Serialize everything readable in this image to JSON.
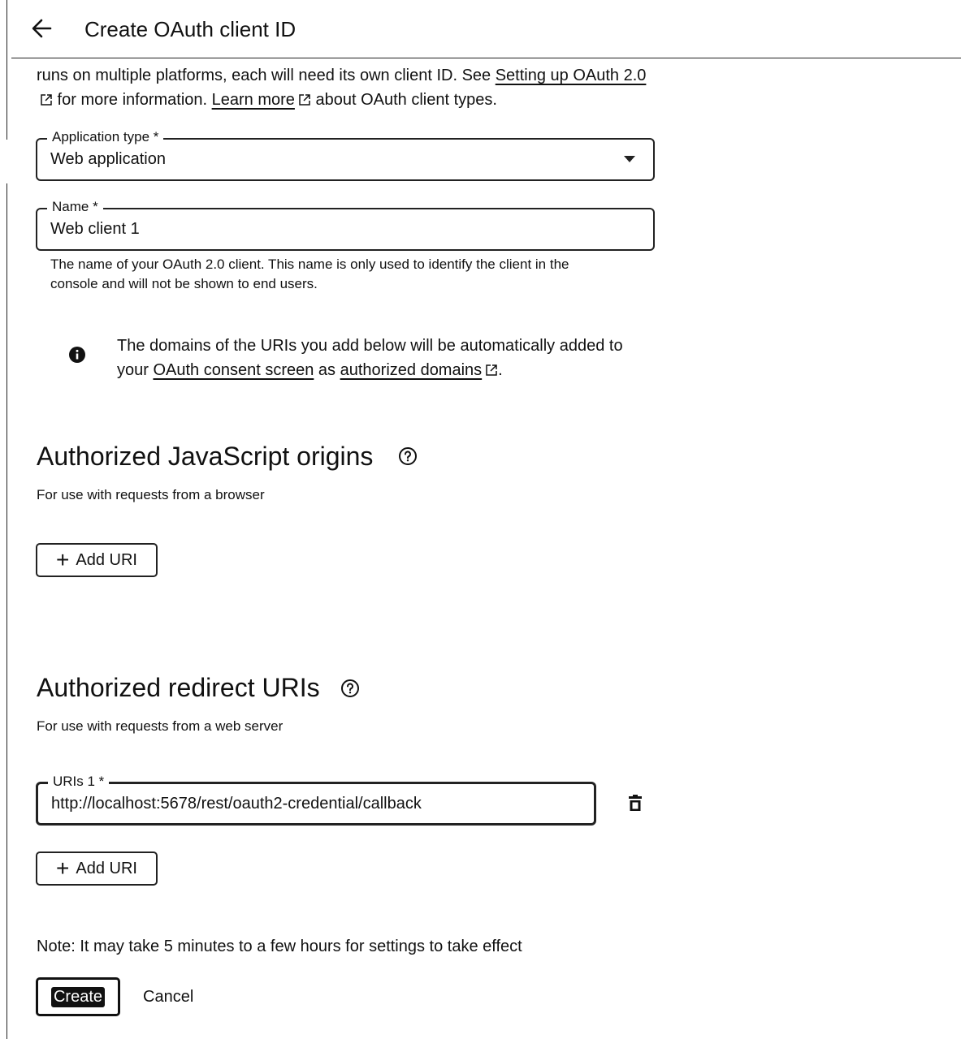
{
  "header": {
    "title": "Create OAuth client ID"
  },
  "intro": {
    "text_before": "runs on multiple platforms, each will need its own client ID. See ",
    "link_setup": "Setting up OAuth 2.0",
    "text_mid": " for more information. ",
    "link_learn": "Learn more",
    "text_after": " about OAuth client types."
  },
  "application_type": {
    "label": "Application type *",
    "value": "Web application"
  },
  "name_field": {
    "label": "Name *",
    "value": "Web client 1",
    "hint": "The name of your OAuth 2.0 client. This name is only used to identify the client in the console and will not be shown to end users."
  },
  "info": {
    "text_before": "The domains of the URIs you add below will be automatically added to your ",
    "link_consent": "OAuth consent screen",
    "text_mid": " as ",
    "link_domains": "authorized domains",
    "text_after": "."
  },
  "js_origins": {
    "title": "Authorized JavaScript origins",
    "subtitle": "For use with requests from a browser",
    "add_label": "Add URI"
  },
  "redirect_uris": {
    "title": "Authorized redirect URIs",
    "subtitle": "For use with requests from a web server",
    "uris": [
      {
        "label": "URIs 1 *",
        "value": "http://localhost:5678/rest/oauth2-credential/callback"
      }
    ],
    "add_label": "Add URI"
  },
  "note": "Note: It may take 5 minutes to a few hours for settings to take effect",
  "actions": {
    "create_label": "Create",
    "cancel_label": "Cancel"
  }
}
